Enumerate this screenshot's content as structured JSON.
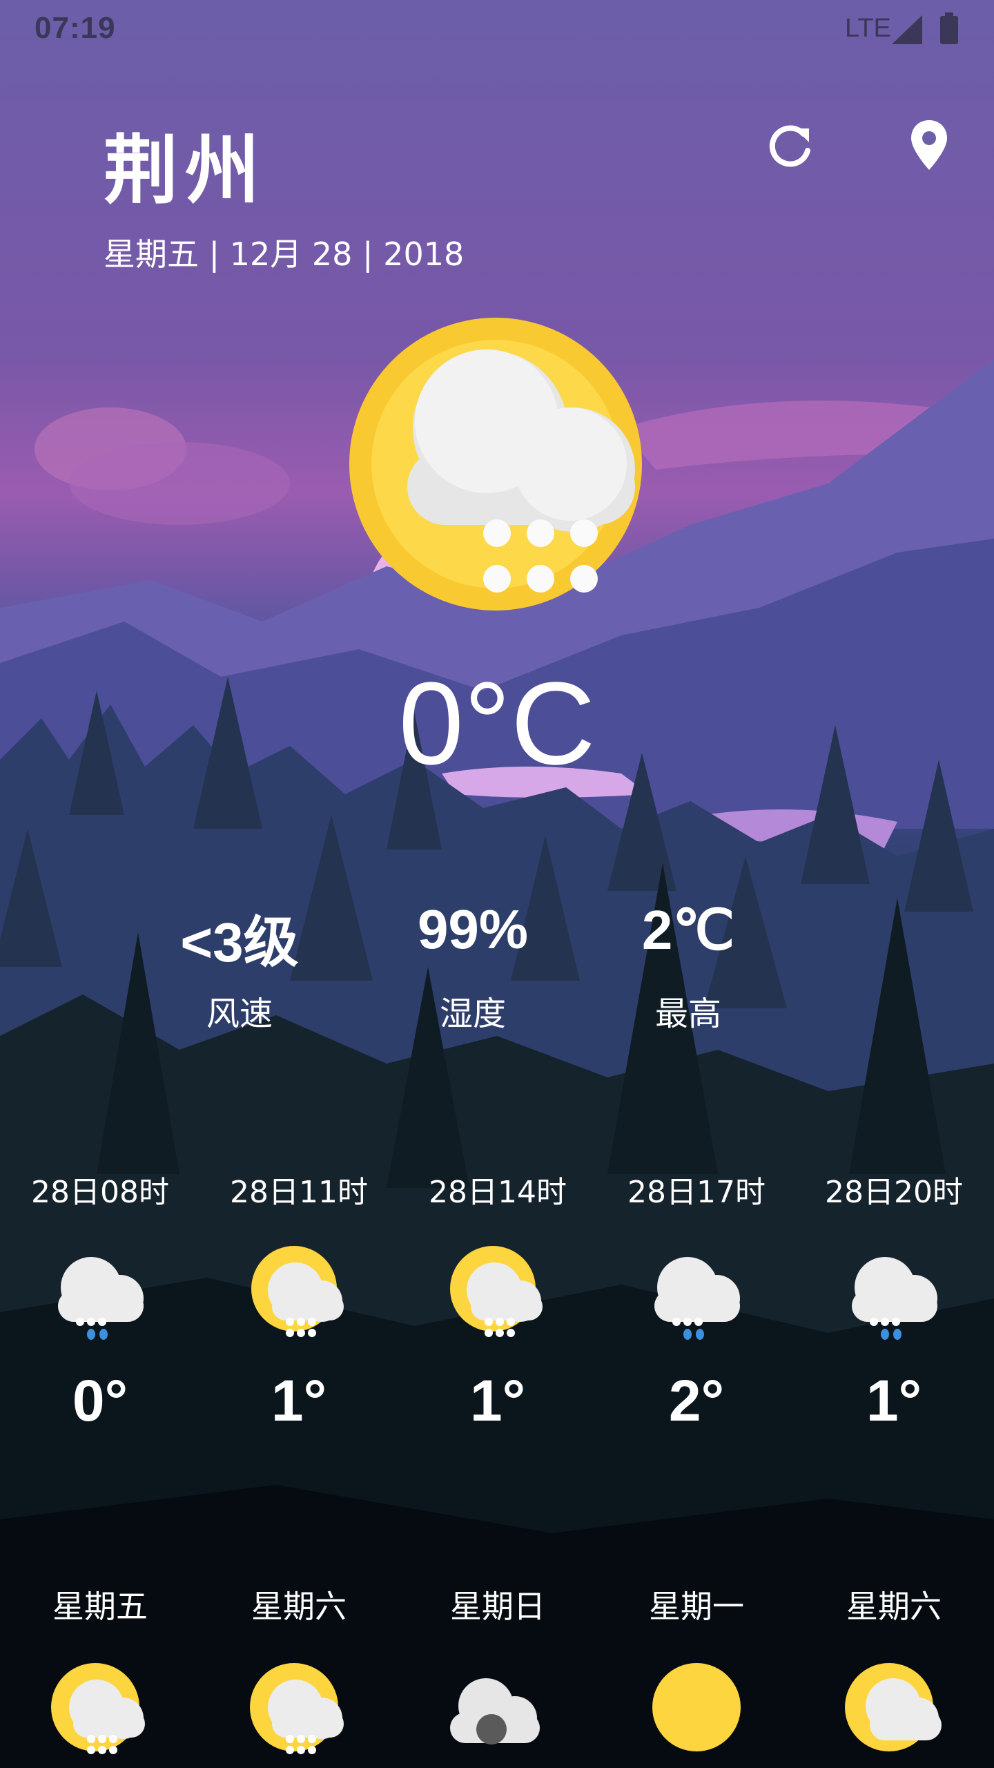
{
  "status": {
    "time": "07:19",
    "network": "LTE"
  },
  "header": {
    "city": "荆州",
    "date": "星期五 | 12月 28 | 2018"
  },
  "icons": {
    "refresh": "refresh-icon",
    "location": "location-pin-icon"
  },
  "current": {
    "temp": "0°C",
    "condition_icon": "light-snow-icon"
  },
  "stats": [
    {
      "value": "<3级",
      "label": "风速"
    },
    {
      "value": "99%",
      "label": "湿度"
    },
    {
      "value": "2℃",
      "label": "最高"
    }
  ],
  "hourly": [
    {
      "time": "28日08时",
      "temp": "0°",
      "icon": "rain-snow-icon"
    },
    {
      "time": "28日11时",
      "temp": "1°",
      "icon": "sun-snow-icon"
    },
    {
      "time": "28日14时",
      "temp": "1°",
      "icon": "sun-snow-icon"
    },
    {
      "time": "28日17时",
      "temp": "2°",
      "icon": "rain-snow-icon"
    },
    {
      "time": "28日20时",
      "temp": "1°",
      "icon": "rain-snow-icon"
    }
  ],
  "daily": [
    {
      "day": "星期五",
      "icon": "sun-snow-icon"
    },
    {
      "day": "星期六",
      "icon": "sun-snow-icon"
    },
    {
      "day": "星期日",
      "icon": "cloud-icon"
    },
    {
      "day": "星期一",
      "icon": "sun-icon"
    },
    {
      "day": "星期六",
      "icon": "partly-cloudy-icon"
    }
  ],
  "colors": {
    "sky": "#6e5ea8",
    "sun": "#fdd53f",
    "cloud": "#ececec",
    "rain": "#3d8fe0"
  }
}
